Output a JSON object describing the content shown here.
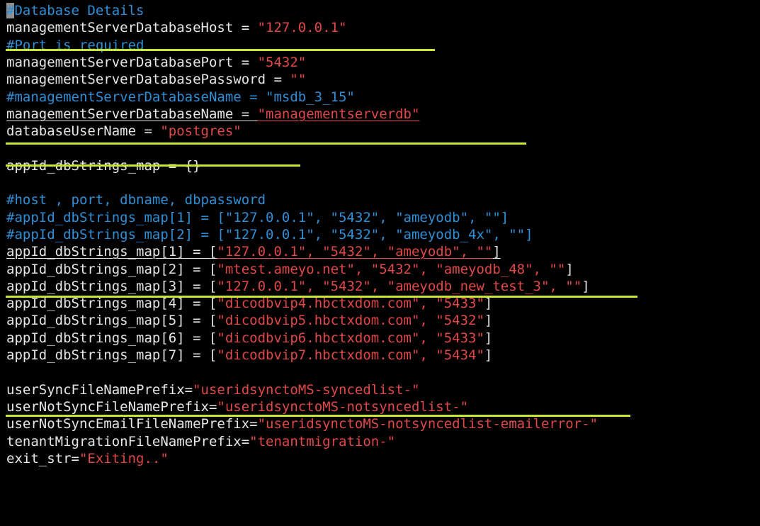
{
  "lines": [
    {
      "parts": [
        {
          "t": "#",
          "c": "cursor"
        },
        {
          "t": "Database Details",
          "c": "comment"
        }
      ]
    },
    {
      "parts": [
        {
          "t": "managementServerDatabaseHost = ",
          "c": "plain"
        },
        {
          "t": "\"127.0.0.1\"",
          "c": "string"
        }
      ]
    },
    {
      "parts": [
        {
          "t": "#Port is required",
          "c": "comment"
        }
      ]
    },
    {
      "parts": [
        {
          "t": "managementServerDatabasePort = ",
          "c": "plain"
        },
        {
          "t": "\"5432\"",
          "c": "string"
        }
      ]
    },
    {
      "parts": [
        {
          "t": "managementServerDatabasePassword = ",
          "c": "plain"
        },
        {
          "t": "\"\"",
          "c": "string"
        }
      ]
    },
    {
      "parts": [
        {
          "t": "#managementServerDatabaseName = \"msdb_3_15\"",
          "c": "comment"
        }
      ]
    },
    {
      "parts": [
        {
          "t": "managementServerDatabaseName = ",
          "c": "plain",
          "u": true
        },
        {
          "t": "\"managementserverdb\"",
          "c": "string",
          "u": true
        }
      ]
    },
    {
      "parts": [
        {
          "t": "databaseUserName = ",
          "c": "plain"
        },
        {
          "t": "\"postgres\"",
          "c": "string"
        }
      ]
    },
    {
      "parts": []
    },
    {
      "parts": [
        {
          "t": "appId_dbStrings_map = {}",
          "c": "plain"
        }
      ]
    },
    {
      "parts": []
    },
    {
      "parts": [
        {
          "t": "#host , port, dbname, dbpassword",
          "c": "comment"
        }
      ]
    },
    {
      "parts": [
        {
          "t": "#appId_dbStrings_map[1] = [\"127.0.0.1\", \"5432\", \"ameyodb\", \"\"]",
          "c": "comment"
        }
      ]
    },
    {
      "parts": [
        {
          "t": "#appId_dbStrings_map[2] = [\"127.0.0.1\", \"5432\", \"ameyodb_4x\", \"\"]",
          "c": "comment"
        }
      ]
    },
    {
      "parts": [
        {
          "t": "appId_dbStrings_map[1] = [",
          "c": "plain",
          "u": true
        },
        {
          "t": "\"127.0.0.1\", \"5432\", \"ameyodb\", \"\"",
          "c": "string",
          "u": true
        },
        {
          "t": "]",
          "c": "plain",
          "u": true
        }
      ]
    },
    {
      "parts": [
        {
          "t": "appId_dbStrings_map[2] = [",
          "c": "plain"
        },
        {
          "t": "\"mtest.ameyo.net\", \"5432\", \"ameyodb_48\", \"\"",
          "c": "string"
        },
        {
          "t": "]",
          "c": "plain"
        }
      ]
    },
    {
      "parts": [
        {
          "t": "appId_dbStrings_map[3] = [",
          "c": "plain"
        },
        {
          "t": "\"127.0.0.1\", \"5432\", \"ameyodb_new_test_3\", \"\"",
          "c": "string"
        },
        {
          "t": "]",
          "c": "plain"
        }
      ]
    },
    {
      "parts": [
        {
          "t": "appId_dbStrings_map[4] = [",
          "c": "plain"
        },
        {
          "t": "\"dicodbvip4.hbctxdom.com\", \"5433\"",
          "c": "string"
        },
        {
          "t": "]",
          "c": "plain"
        }
      ]
    },
    {
      "parts": [
        {
          "t": "appId_dbStrings_map[5] = [",
          "c": "plain"
        },
        {
          "t": "\"dicodbvip5.hbctxdom.com\", \"5432\"",
          "c": "string"
        },
        {
          "t": "]",
          "c": "plain"
        }
      ]
    },
    {
      "parts": [
        {
          "t": "appId_dbStrings_map[6] = [",
          "c": "plain"
        },
        {
          "t": "\"dicodbvip6.hbctxdom.com\", \"5433\"",
          "c": "string"
        },
        {
          "t": "]",
          "c": "plain"
        }
      ]
    },
    {
      "parts": [
        {
          "t": "appId_dbStrings_map[7] = [",
          "c": "plain"
        },
        {
          "t": "\"dicodbvip7.hbctxdom.com\", \"5434\"",
          "c": "string"
        },
        {
          "t": "]",
          "c": "plain"
        }
      ]
    },
    {
      "parts": []
    },
    {
      "parts": [
        {
          "t": "userSyncFileNamePrefix=",
          "c": "plain"
        },
        {
          "t": "\"useridsynctoMS-syncedlist-\"",
          "c": "string"
        }
      ]
    },
    {
      "parts": [
        {
          "t": "userNotSyncFileNamePrefix=",
          "c": "plain"
        },
        {
          "t": "\"useridsynctoMS-notsyncedlist-\"",
          "c": "string"
        }
      ]
    },
    {
      "parts": [
        {
          "t": "userNotSyncEmailFileNamePrefix=",
          "c": "plain"
        },
        {
          "t": "\"useridsynctoMS-notsyncedlist-emailerror-\"",
          "c": "string"
        }
      ]
    },
    {
      "parts": [
        {
          "t": "tenantMigrationFileNamePrefix=",
          "c": "plain"
        },
        {
          "t": "\"tenantmigration-\"",
          "c": "string"
        }
      ]
    },
    {
      "parts": [
        {
          "t": "exit_str=",
          "c": "plain"
        },
        {
          "t": "\"Exiting..\"",
          "c": "string"
        }
      ]
    }
  ],
  "highlight_color": "#c8e632"
}
